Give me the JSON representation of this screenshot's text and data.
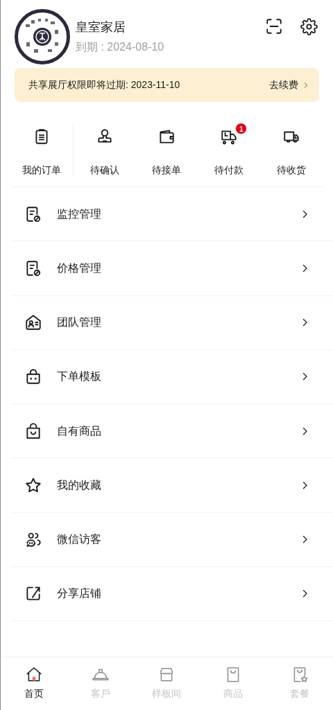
{
  "profile": {
    "name": "皇室家居",
    "expiry": "到期 : 2024-08-10"
  },
  "notice": {
    "text": "共享展厅权限即将过期: 2023-11-10",
    "action": "去续费"
  },
  "orders": [
    {
      "label": "我的订单"
    },
    {
      "label": "待确认"
    },
    {
      "label": "待接单"
    },
    {
      "label": "待付款",
      "badge": "1"
    },
    {
      "label": "待收货"
    }
  ],
  "menu": [
    {
      "label": "监控管理"
    },
    {
      "label": "价格管理"
    },
    {
      "label": "团队管理"
    },
    {
      "label": "下单模板"
    },
    {
      "label": "自有商品"
    },
    {
      "label": "我的收藏"
    },
    {
      "label": "微信访客"
    },
    {
      "label": "分享店铺"
    }
  ],
  "tab_bar": [
    {
      "label": "首页",
      "selected": true
    },
    {
      "label": "客戶",
      "selected": false
    },
    {
      "label": "样板间",
      "selected": false
    },
    {
      "label": "商品",
      "selected": false
    },
    {
      "label": "套餐",
      "selected": false
    }
  ]
}
